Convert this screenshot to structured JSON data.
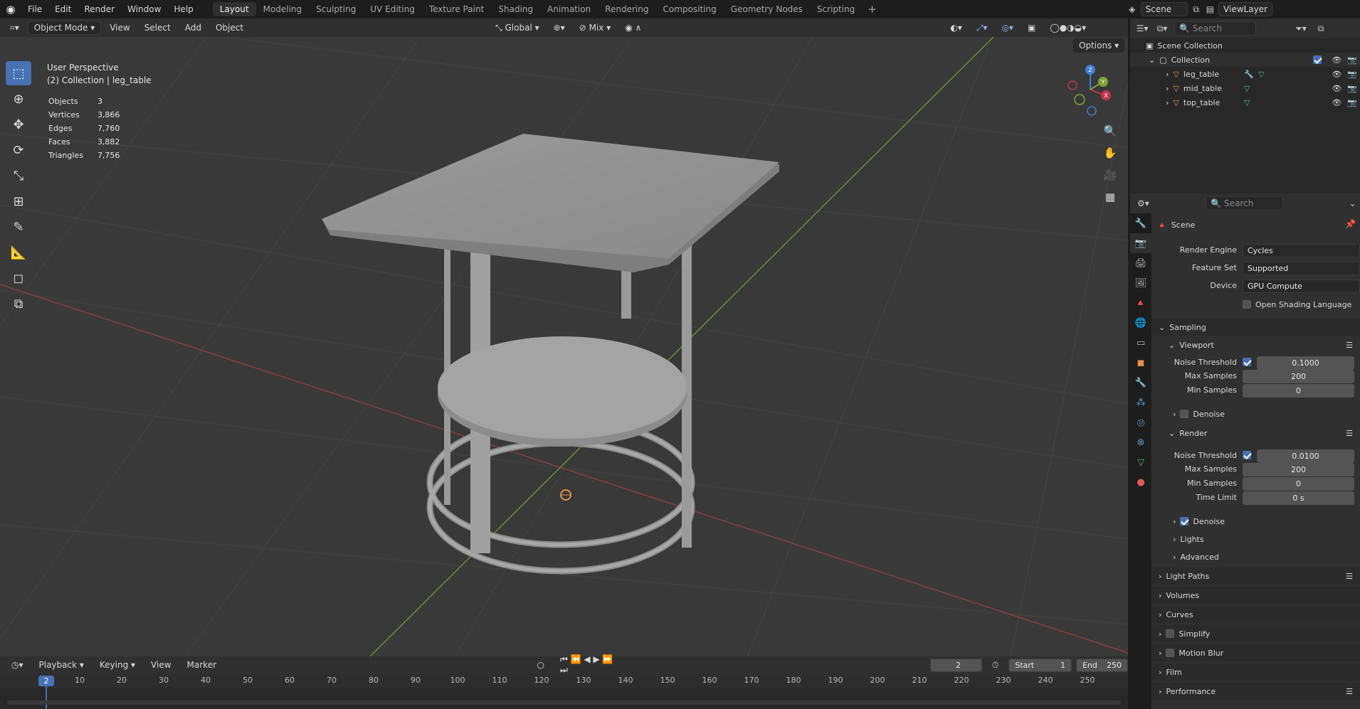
{
  "menu": [
    "File",
    "Edit",
    "Render",
    "Window",
    "Help"
  ],
  "workspaces": [
    "Layout",
    "Modeling",
    "Sculpting",
    "UV Editing",
    "Texture Paint",
    "Shading",
    "Animation",
    "Rendering",
    "Compositing",
    "Geometry Nodes",
    "Scripting"
  ],
  "active_workspace": "Layout",
  "scene_name": "Scene",
  "view_layer": "ViewLayer",
  "viewport": {
    "mode": "Object Mode",
    "menus": [
      "View",
      "Select",
      "Add",
      "Object"
    ],
    "orientation": "Global",
    "snap_mode": "Mix",
    "options_label": "Options",
    "perspective": "User Perspective",
    "context": "(2) Collection | leg_table",
    "stats": [
      {
        "label": "Objects",
        "value": "3"
      },
      {
        "label": "Vertices",
        "value": "3,866"
      },
      {
        "label": "Edges",
        "value": "7,760"
      },
      {
        "label": "Faces",
        "value": "3,882"
      },
      {
        "label": "Triangles",
        "value": "7,756"
      }
    ],
    "gizmo_axes": {
      "x": "X",
      "y": "Y",
      "z": "Z"
    }
  },
  "timeline": {
    "menus": [
      "Playback",
      "Keying",
      "View",
      "Marker"
    ],
    "current_frame": "2",
    "start_label": "Start",
    "start": "1",
    "end_label": "End",
    "end": "250",
    "ticks": [
      "10",
      "20",
      "30",
      "40",
      "50",
      "60",
      "70",
      "80",
      "90",
      "100",
      "110",
      "120",
      "130",
      "140",
      "150",
      "160",
      "170",
      "180",
      "190",
      "200",
      "210",
      "220",
      "230",
      "240",
      "250"
    ],
    "marker_frame": "2"
  },
  "outliner": {
    "search_placeholder": "Search",
    "root": "Scene Collection",
    "collection": "Collection",
    "objects": [
      "leg_table",
      "mid_table",
      "top_table"
    ]
  },
  "properties": {
    "search_placeholder": "Search",
    "context": "Scene",
    "render_engine_label": "Render Engine",
    "render_engine": "Cycles",
    "feature_set_label": "Feature Set",
    "feature_set": "Supported",
    "device_label": "Device",
    "device": "GPU Compute",
    "osl_label": "Open Shading Language",
    "sampling": "Sampling",
    "viewport_panel": "Viewport",
    "render_panel": "Render",
    "noise_threshold_label": "Noise Threshold",
    "max_samples_label": "Max Samples",
    "min_samples_label": "Min Samples",
    "time_limit_label": "Time Limit",
    "denoise_label": "Denoise",
    "viewport_noise": "0.1000",
    "viewport_max": "200",
    "viewport_min": "0",
    "render_noise": "0.0100",
    "render_max": "200",
    "render_min": "0",
    "time_limit": "0 s",
    "lights": "Lights",
    "advanced": "Advanced",
    "light_paths": "Light Paths",
    "volumes": "Volumes",
    "curves": "Curves",
    "simplify": "Simplify",
    "motion_blur": "Motion Blur",
    "film": "Film",
    "performance": "Performance"
  },
  "colors": {
    "accent": "#4772b3",
    "x_axis": "#c1354a",
    "y_axis": "#7ea33a",
    "z_axis": "#3f7fd6",
    "object": "#e5904a"
  }
}
